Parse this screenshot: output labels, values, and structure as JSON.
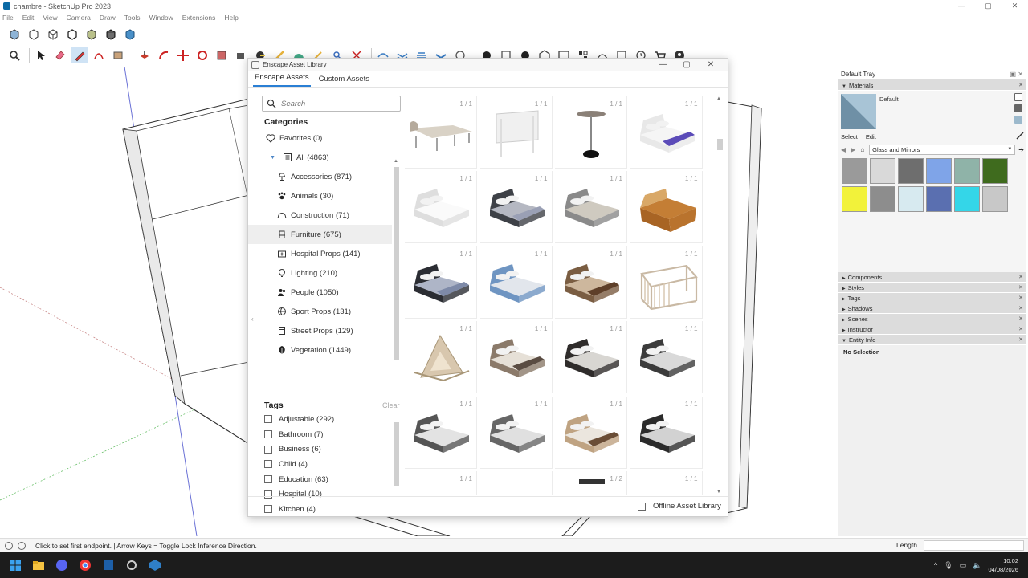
{
  "window": {
    "title": "chambre - SketchUp Pro 2023",
    "controls": [
      "—",
      "▢",
      "✕"
    ]
  },
  "menu": [
    "File",
    "Edit",
    "View",
    "Camera",
    "Draw",
    "Tools",
    "Window",
    "Extensions",
    "Help"
  ],
  "dialog": {
    "title": "Enscape Asset Library",
    "tabs": [
      "Enscape Assets",
      "Custom Assets"
    ],
    "search_placeholder": "Search",
    "categories_heading": "Categories",
    "categories": [
      {
        "label": "Favorites (0)",
        "icon": "heart-icon"
      },
      {
        "label": "All (4863)",
        "icon": "list-icon"
      },
      {
        "label": "Accessories (871)",
        "icon": "lamp-icon"
      },
      {
        "label": "Animals (30)",
        "icon": "paw-icon"
      },
      {
        "label": "Construction (71)",
        "icon": "helmet-icon"
      },
      {
        "label": "Furniture (675)",
        "icon": "chair-icon"
      },
      {
        "label": "Hospital Props (141)",
        "icon": "medkit-icon"
      },
      {
        "label": "Lighting (210)",
        "icon": "bulb-icon"
      },
      {
        "label": "People (1050)",
        "icon": "people-icon"
      },
      {
        "label": "Sport Props (131)",
        "icon": "ball-icon"
      },
      {
        "label": "Street Props (129)",
        "icon": "street-icon"
      },
      {
        "label": "Vegetation (1449)",
        "icon": "leaf-icon"
      }
    ],
    "tags_heading": "Tags",
    "tags_clear": "Clear",
    "tags": [
      "Adjustable (292)",
      "Bathroom (7)",
      "Business (6)",
      "Child (4)",
      "Education (63)",
      "Hospital (10)",
      "Kitchen (4)"
    ],
    "asset_counts": [
      "1 / 1",
      "1 / 1",
      "1 / 1",
      "1 / 1",
      "1 / 1",
      "1 / 1",
      "1 / 1",
      "1 / 1",
      "1 / 1",
      "1 / 1",
      "1 / 1",
      "1 / 1",
      "1 / 1",
      "1 / 1",
      "1 / 1",
      "1 / 1",
      "1 / 1",
      "1 / 1",
      "1 / 1",
      "1 / 1",
      "1 / 1",
      "",
      "1 / 2",
      "1 / 1"
    ],
    "offline_label": "Offline Asset Library"
  },
  "tray": {
    "title": "Default Tray",
    "materials_heading": "Materials",
    "material_name": "Default",
    "select_tab": "Select",
    "edit_tab": "Edit",
    "library": "Glass and Mirrors",
    "swatch_colors": [
      "#9a9a9a",
      "#d9d9d9",
      "#6e6e6e",
      "#7fa4e8",
      "#8fb3a8",
      "#3f6b1e",
      "#f2f23a",
      "#8d8d8d",
      "#d7eaf0",
      "#5a6fb0",
      "#34d6e8",
      "#c8c8c8"
    ],
    "panels": [
      "Components",
      "Styles",
      "Tags",
      "Shadows",
      "Scenes",
      "Instructor",
      "Entity Info"
    ],
    "entity_info": "No Selection"
  },
  "status": {
    "message": "Click to set first endpoint. | Arrow Keys = Toggle Lock Inference Direction.",
    "measurement_label": "Length"
  },
  "taskbar": {
    "time": "10:02",
    "date": "04/08/2026"
  }
}
